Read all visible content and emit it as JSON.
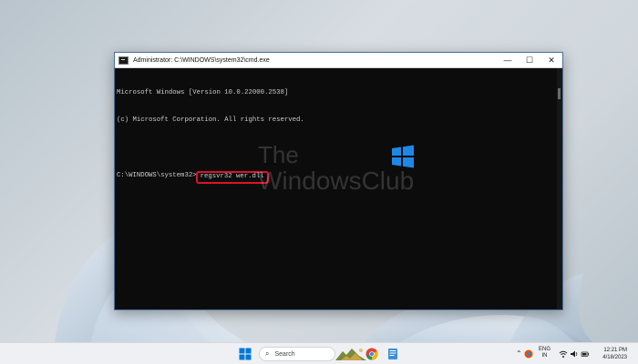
{
  "window": {
    "title": "Administrator: C:\\WINDOWS\\system32\\cmd.exe",
    "minimize_glyph": "—",
    "maximize_glyph": "☐",
    "close_glyph": "✕"
  },
  "console": {
    "lines": [
      "Microsoft Windows [Version 10.0.22000.2538]",
      "(c) Microsoft Corporation. All rights reserved.",
      ""
    ],
    "prompt": "C:\\WINDOWS\\system32>",
    "command": "regsvr32 wer.dll"
  },
  "watermark": {
    "line1": "The",
    "line2": "WindowsClub",
    "logo_color": "#1e88e5"
  },
  "taskbar": {
    "search_label": "Search",
    "lang_top": "ENG",
    "lang_bottom": "IN",
    "time": "12:21 PM",
    "date": "4/18/2023"
  },
  "colors": {
    "highlight": "#e0102a",
    "console_bg": "#0c0c0c",
    "console_text": "#cccccc",
    "window_border": "#4a6f96"
  },
  "icons": {
    "start": "windows-start-icon",
    "search": "search-icon",
    "chrome": "chrome-icon",
    "notepad": "notepad-icon",
    "tray_up": "chevron-up-icon",
    "wifi": "wifi-icon",
    "volume": "speaker-icon",
    "battery": "battery-icon"
  }
}
